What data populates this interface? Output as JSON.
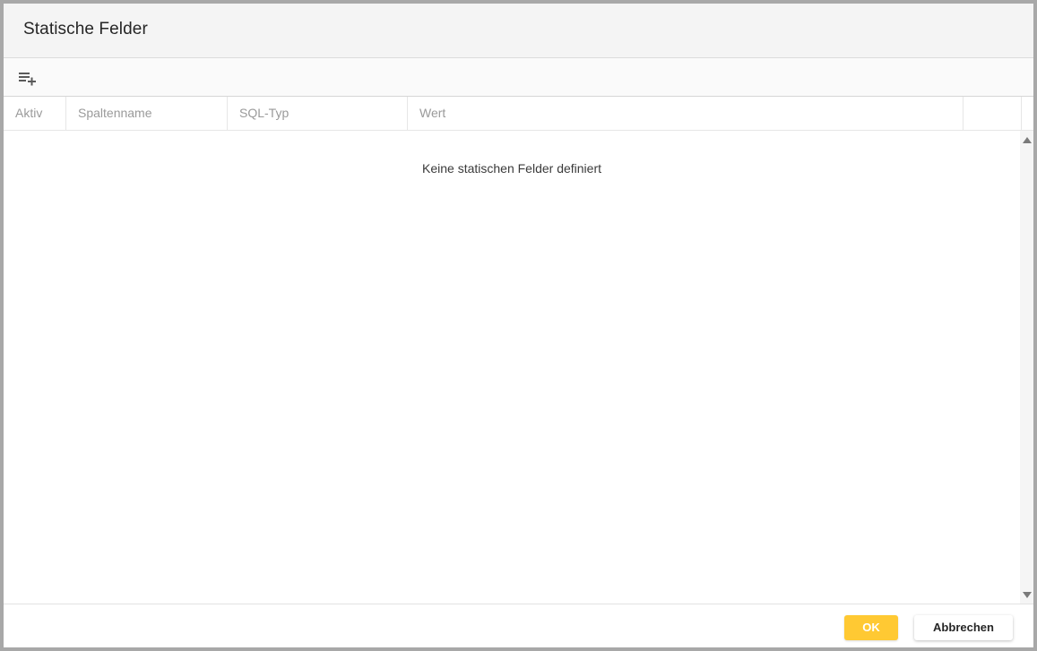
{
  "dialog": {
    "title": "Statische Felder"
  },
  "toolbar": {
    "add_row_icon": "playlist-add-icon"
  },
  "table": {
    "columns": [
      {
        "label": "Aktiv"
      },
      {
        "label": "Spaltenname"
      },
      {
        "label": "SQL-Typ"
      },
      {
        "label": "Wert"
      },
      {
        "label": ""
      }
    ],
    "empty_message": "Keine statischen Felder definiert"
  },
  "footer": {
    "ok_label": "OK",
    "cancel_label": "Abbrechen"
  },
  "colors": {
    "accent": "#ffc933",
    "header_text": "#9a9a9a",
    "title_bar_bg": "#f4f4f4"
  }
}
